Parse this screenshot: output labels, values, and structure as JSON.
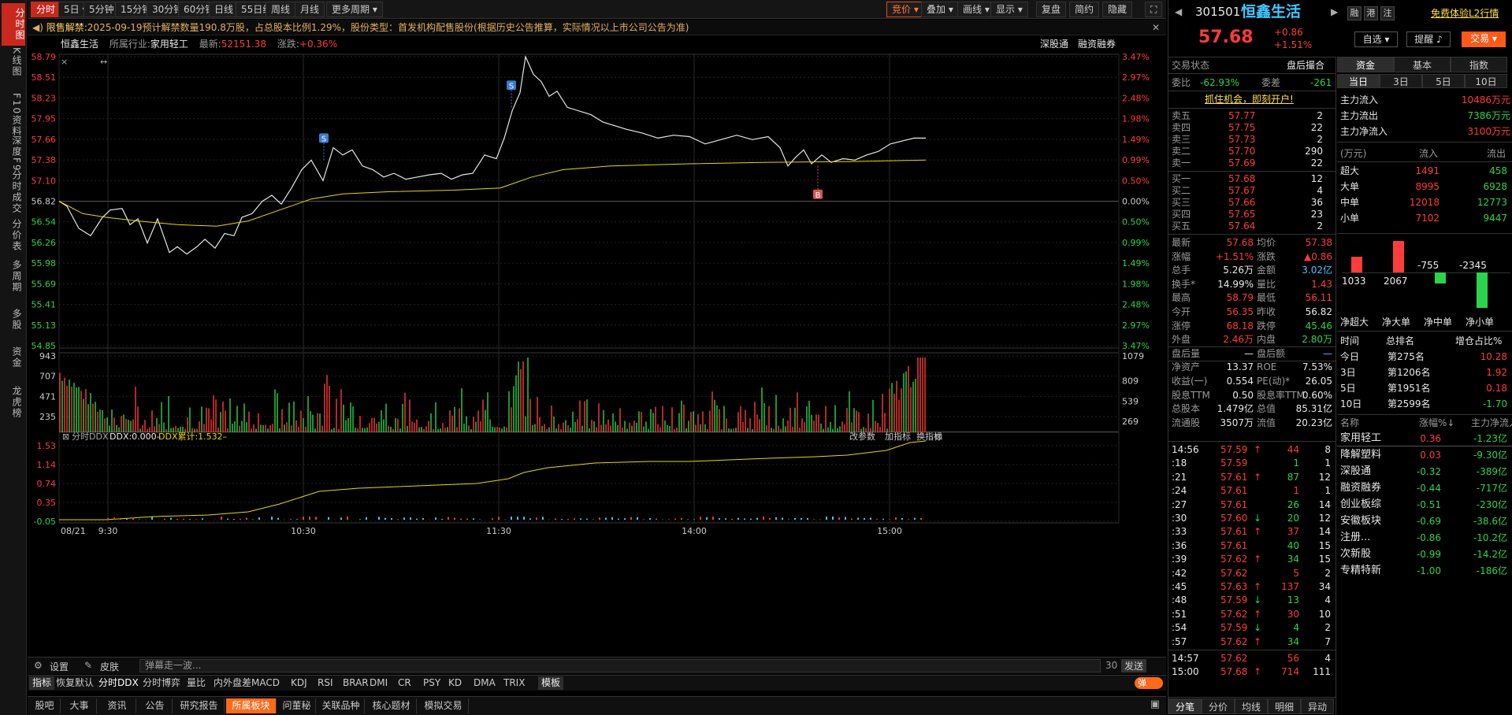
{
  "leftbar": [
    "分时图",
    "K线图",
    "F10资料",
    "深度F9",
    "分时成交",
    "分价表",
    "多周期",
    "多股",
    "资金",
    "龙虎榜"
  ],
  "topbar": {
    "periods": [
      "分时",
      "5日",
      "5分钟",
      "15分钟",
      "30分钟",
      "60分钟",
      "日线",
      "55日线",
      "周线",
      "月线",
      "更多周期"
    ],
    "tools": [
      "竞价",
      "叠加",
      "画线",
      "显示",
      "复盘",
      "简约",
      "隐藏"
    ]
  },
  "notice": {
    "tag": "限售解禁:",
    "text": "2025-09-19预计解禁数量190.8万股，占总股本比例1.29%，股份类型：首发机构配售股份(根据历史公告推算，实际情况以上市公司公告为准)"
  },
  "info": {
    "name": "恒鑫生活",
    "industry_label": "所属行业:",
    "industry": "家用轻工",
    "latest_label": "最新:",
    "latest": "52151.38",
    "change_label": "涨跌:",
    "change": "+0.36%",
    "links": [
      "深股通",
      "融资融券"
    ]
  },
  "price_axis": {
    "left": [
      "58.79",
      "58.51",
      "58.23",
      "57.95",
      "57.66",
      "57.38",
      "57.10",
      "56.82",
      "56.54",
      "56.26",
      "55.98",
      "55.69",
      "55.41",
      "55.13",
      "54.85"
    ],
    "right": [
      "3.47%",
      "2.97%",
      "2.48%",
      "1.98%",
      "1.49%",
      "0.99%",
      "0.50%",
      "0.00%",
      "0.50%",
      "0.99%",
      "1.49%",
      "1.98%",
      "2.48%",
      "2.97%",
      "3.47%"
    ]
  },
  "vol_axis": {
    "left": [
      "943",
      "707",
      "471",
      "235"
    ],
    "right": [
      "1079",
      "809",
      "539",
      "269"
    ]
  },
  "ddx": {
    "title": "分时DDX",
    "ddx_label": "DDX:0.000–",
    "cum_label": "DDX累计:1.532–",
    "left": [
      "1.53",
      "1.14",
      "0.74",
      "0.35",
      "-0.05"
    ],
    "tools": [
      "改参数",
      "加指标",
      "换指标"
    ]
  },
  "time_axis": [
    "08/21",
    "9:30",
    "10:30",
    "11:30",
    "14:00",
    "15:00"
  ],
  "markers": {
    "s": "S",
    "b": "B"
  },
  "bottom": {
    "settings": "设置",
    "skin": "皮肤",
    "danmu": "弹幕走一波...",
    "count": "30",
    "send": "发送",
    "indicator_tabs": [
      "指标",
      "恢复默认",
      "分时DDX",
      "分时博弈",
      "量比",
      "内外盘差",
      "MACD",
      "KDJ",
      "RSI",
      "BRAR",
      "DMI",
      "CR",
      "PSY",
      "KD",
      "DMA",
      "TRIX",
      "模板"
    ],
    "toggle": "弹",
    "nav_tabs": [
      "股吧",
      "大事",
      "资讯",
      "公告",
      "研究报告",
      "所属板块",
      "问董秘",
      "关联品种",
      "核心题材",
      "模拟交易"
    ]
  },
  "stock": {
    "code": "301501",
    "name": "恒鑫生活",
    "price": "57.68",
    "chg": "+0.86",
    "pct": "+1.51%",
    "btns": [
      "融",
      "港",
      "注"
    ],
    "l2": "免费体验L2行情",
    "zixuan": "自选",
    "remind": "提醒",
    "trade": "交易"
  },
  "status": {
    "label": "交易状态",
    "value": "盘后撮合"
  },
  "weibi": {
    "l1": "委比",
    "v1": "-62.93%",
    "l2": "委差",
    "v2": "-261"
  },
  "ad": "抓住机会，即刻开户!",
  "asks": [
    [
      "卖五",
      "57.77",
      "2"
    ],
    [
      "卖四",
      "57.75",
      "22"
    ],
    [
      "卖三",
      "57.73",
      "2"
    ],
    [
      "卖二",
      "57.70",
      "290"
    ],
    [
      "卖一",
      "57.69",
      "22"
    ]
  ],
  "bids": [
    [
      "买一",
      "57.68",
      "12"
    ],
    [
      "买二",
      "57.67",
      "4"
    ],
    [
      "买三",
      "57.66",
      "36"
    ],
    [
      "买四",
      "57.65",
      "23"
    ],
    [
      "买五",
      "57.64",
      "2"
    ]
  ],
  "quote": [
    [
      "最新",
      "57.68",
      "均价",
      "57.38"
    ],
    [
      "涨幅",
      "+1.51%",
      "涨跌",
      "▲0.86"
    ],
    [
      "总手",
      "5.26万",
      "金额",
      "3.02亿"
    ],
    [
      "换手*",
      "14.99%",
      "量比",
      "1.43"
    ],
    [
      "最高",
      "58.79",
      "最低",
      "56.11"
    ],
    [
      "今开",
      "56.35",
      "昨收",
      "56.82"
    ],
    [
      "涨停",
      "68.18",
      "跌停",
      "45.46"
    ],
    [
      "外盘",
      "2.46万",
      "内盘",
      "2.80万"
    ],
    [
      "盘后量",
      "—",
      "盘后额",
      "—"
    ],
    [
      "净资产",
      "13.37",
      "ROE",
      "7.53%"
    ],
    [
      "收益(一)",
      "0.554",
      "PE(动)*",
      "26.05"
    ],
    [
      "股息TTM",
      "0.50",
      "股息率TTM",
      "0.60%"
    ],
    [
      "总股本",
      "1.479亿",
      "总值",
      "85.31亿"
    ],
    [
      "流通股",
      "3507万",
      "流值",
      "20.23亿"
    ]
  ],
  "ticks": [
    [
      "14:56",
      "57.59",
      "↑",
      "44",
      "8"
    ],
    [
      ":18",
      "57.59",
      "",
      "1",
      "1"
    ],
    [
      ":21",
      "57.61",
      "↑",
      "87",
      "12"
    ],
    [
      ":24",
      "57.61",
      "",
      "1",
      "1"
    ],
    [
      ":27",
      "57.61",
      "",
      "26",
      "14"
    ],
    [
      ":30",
      "57.60",
      "↓",
      "20",
      "12"
    ],
    [
      ":33",
      "57.61",
      "↑",
      "37",
      "14"
    ],
    [
      ":36",
      "57.61",
      "",
      "40",
      "15"
    ],
    [
      ":39",
      "57.62",
      "↑",
      "34",
      "15"
    ],
    [
      ":42",
      "57.62",
      "",
      "5",
      "2"
    ],
    [
      ":45",
      "57.63",
      "↑",
      "137",
      "34"
    ],
    [
      ":48",
      "57.59",
      "↓",
      "13",
      "4"
    ],
    [
      ":51",
      "57.62",
      "↑",
      "30",
      "10"
    ],
    [
      ":54",
      "57.59",
      "↓",
      "4",
      "2"
    ],
    [
      ":57",
      "57.62",
      "↑",
      "34",
      "7"
    ],
    [
      "14:57",
      "57.62",
      "",
      "56",
      "4"
    ],
    [
      "15:00",
      "57.68",
      "↑",
      "714",
      "111"
    ]
  ],
  "tick_tabs": [
    "分笔",
    "分价",
    "均线",
    "明细",
    "异动"
  ],
  "fund": {
    "tabs": [
      "资金",
      "基本",
      "指数"
    ],
    "days": [
      "当日",
      "3日",
      "5日",
      "10日"
    ],
    "flows": [
      [
        "主力流入",
        "10486万元"
      ],
      [
        "主力流出",
        "7386万元"
      ],
      [
        "主力净流入",
        "3100万元"
      ]
    ],
    "tbl_head": [
      "(万元)",
      "流入",
      "流出"
    ],
    "tbl": [
      [
        "超大",
        "1491",
        "458"
      ],
      [
        "大单",
        "8995",
        "6928"
      ],
      [
        "中单",
        "12018",
        "12773"
      ],
      [
        "小单",
        "7102",
        "9447"
      ]
    ],
    "net": [
      {
        "label": "净超大",
        "value": 1033
      },
      {
        "label": "净大单",
        "value": 2067
      },
      {
        "label": "净中单",
        "value": -755
      },
      {
        "label": "净小单",
        "value": -2345
      }
    ],
    "rank_head": [
      "时间",
      "总排名",
      "增仓占比%"
    ],
    "rank": [
      [
        "今日",
        "第275名",
        "10.28"
      ],
      [
        "3日",
        "第1206名",
        "1.92"
      ],
      [
        "5日",
        "第1951名",
        "0.18"
      ],
      [
        "10日",
        "第2599名",
        "-1.70"
      ]
    ],
    "sector_head": [
      "名称",
      "涨幅%↓",
      "主力净流入"
    ],
    "sectors": [
      [
        "家用轻工",
        "0.36",
        "-1.23亿"
      ],
      [
        "降解塑料",
        "0.03",
        "-9.30亿"
      ],
      [
        "深股通",
        "-0.32",
        "-389亿"
      ],
      [
        "融资融券",
        "-0.44",
        "-717亿"
      ],
      [
        "创业板综",
        "-0.51",
        "-230亿"
      ],
      [
        "安徽板块",
        "-0.69",
        "-38.6亿"
      ],
      [
        "注册...",
        "-0.86",
        "-10.2亿"
      ],
      [
        "次新股",
        "-0.99",
        "-14.2亿"
      ],
      [
        "专精特新",
        "-1.00",
        "-186亿"
      ]
    ]
  },
  "colors": {
    "up": "#ff3b3b",
    "down": "#2bd44b",
    "avg": "#e8d800",
    "price": "#e6e6e6"
  }
}
